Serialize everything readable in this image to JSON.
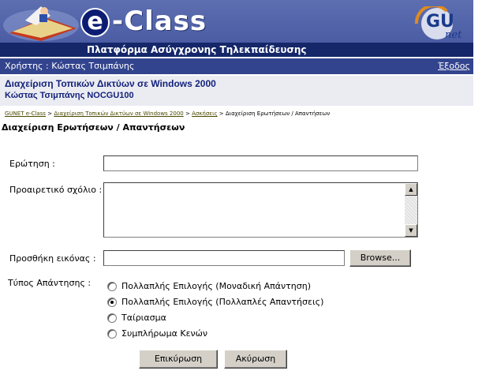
{
  "banner": {
    "logo_letter": "e",
    "logo_text": "-Class",
    "subtitle": "Πλατφόρμα Ασύγχρονης Τηλεκπαίδευσης",
    "partner_logo_text": "GU",
    "partner_logo_sub": "net"
  },
  "user_bar": {
    "user_label": "Χρήστης : Κώστας Τσιμπάνης",
    "logout": "Έξοδος"
  },
  "course": {
    "title": "Διαχείριση Τοπικών Δικτύων σε Windows 2000",
    "code": "Κώστας Τσιμπάνης NOCGU100"
  },
  "breadcrumb": {
    "items": [
      "GUNET e-Class",
      "Διαχείριση Τοπικών Δικτύων σε Windows 2000",
      "Ασκήσεις",
      "Διαχείριση Ερωτήσεων / Απαντήσεων"
    ],
    "separator": ">"
  },
  "page": {
    "title": "Διαχείριση Ερωτήσεων / Απαντήσεων"
  },
  "form": {
    "question_label": "Ερώτηση :",
    "question_value": "",
    "comment_label": "Προαιρετικό σχόλιο :",
    "comment_value": "",
    "image_label": "Προσθήκη εικόνας :",
    "image_value": "",
    "browse_button": "Browse...",
    "answer_type_label": "Τύπος Απάντησης :",
    "answer_types": [
      {
        "label": "Πολλαπλής Επιλογής (Μοναδική Απάντηση)",
        "checked": false
      },
      {
        "label": "Πολλαπλής Επιλογής (Πολλαπλές Απαντήσεις)",
        "checked": true
      },
      {
        "label": "Ταίριασμα",
        "checked": false
      },
      {
        "label": "Συμπλήρωμα Κενών",
        "checked": false
      }
    ],
    "submit_button": "Επικύρωση",
    "cancel_button": "Ακύρωση"
  },
  "colors": {
    "banner": "#4556a0",
    "banner_dark": "#152769",
    "user_bar": "#33448e",
    "course_text": "#13227a",
    "course_bg": "#ebecf2"
  }
}
